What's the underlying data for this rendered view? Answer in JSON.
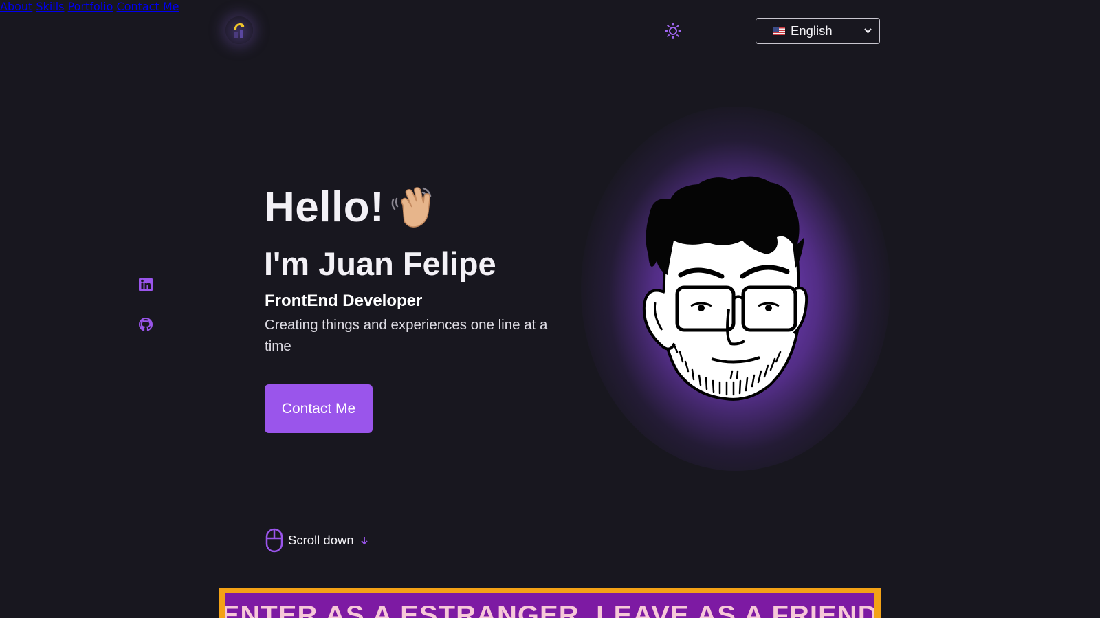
{
  "header": {
    "nav": [
      {
        "label": "About"
      },
      {
        "label": "Skills"
      },
      {
        "label": "Portfolio"
      },
      {
        "label": "Contact Me"
      }
    ],
    "theme_toggle_icon": "sun-icon",
    "language": {
      "selected": "English",
      "flag_icon": "us-flag-icon"
    }
  },
  "social": [
    {
      "icon": "linkedin-icon"
    },
    {
      "icon": "github-icon"
    }
  ],
  "hero": {
    "greeting": "Hello!",
    "greeting_icon": "waving-hand-icon",
    "name": "I'm Juan Felipe",
    "role": "FrontEnd Developer",
    "tagline": "Creating things and experiences one line at a time",
    "cta_label": "Contact Me"
  },
  "scroll": {
    "label": "Scroll down",
    "icon": "mouse-icon",
    "arrow_icon": "arrow-down-icon"
  },
  "banner": {
    "text": "ENTER AS A ESTRANGER, LEAVE AS A FRIEND"
  },
  "colors": {
    "background": "#18171f",
    "accent": "#9a55eb",
    "banner_border": "#f3a216",
    "banner_fill": "#7d1aa3"
  }
}
